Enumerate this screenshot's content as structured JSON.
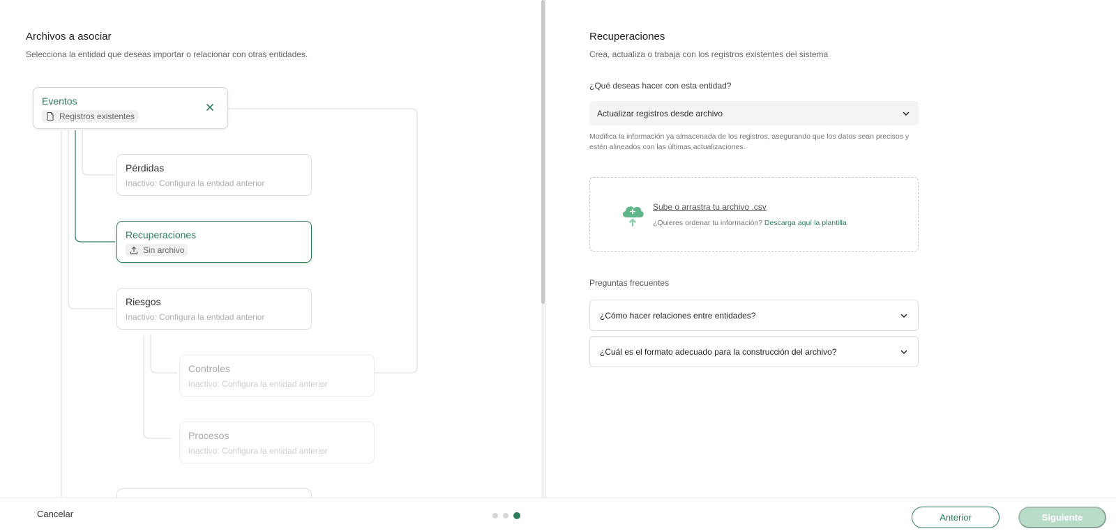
{
  "left": {
    "title": "Archivos a asociar",
    "subtitle": "Selecciona la entidad que deseas importar o relacionar con otras entidades.",
    "root": {
      "title": "Eventos",
      "chip_label": "Registros existentes",
      "chip_icon": "file-icon"
    },
    "nodes": [
      {
        "title": "Pérdidas",
        "subtitle": "Inactivo: Configura la entidad anterior",
        "state": "inactive"
      },
      {
        "title": "Recuperaciones",
        "chip_label": "Sin archivo",
        "chip_icon": "upload-icon",
        "state": "active"
      },
      {
        "title": "Riesgos",
        "subtitle": "Inactivo: Configura la entidad anterior",
        "state": "inactive"
      },
      {
        "title": "Controles",
        "subtitle": "Inactivo: Configura la entidad anterior",
        "state": "disabled"
      },
      {
        "title": "Procesos",
        "subtitle": "Inactivo: Configura la entidad anterior",
        "state": "disabled"
      }
    ]
  },
  "right": {
    "title": "Recuperaciones",
    "subtitle": "Crea, actualiza o trabaja con los registros existentes del sistema",
    "question": "¿Qué deseas hacer con esta entidad?",
    "select_value": "Actualizar registros desde archivo",
    "description": "Modifica la información ya almacenada de los registros, asegurando que los datos sean precisos y estén alineados con las últimas actualizaciones.",
    "upload": {
      "link_text": "Sube o arrastra tu archivo .csv",
      "hint_text": "¿Quieres ordenar tu información?",
      "template_link": "Descarga aquí la plantilla"
    },
    "faq_title": "Preguntas frecuentes",
    "faq": [
      {
        "question": "¿Cómo hacer relaciones entre entidades?"
      },
      {
        "question": "¿Cuál es el formato adecuado para la construcción del archivo?"
      }
    ]
  },
  "footer": {
    "cancel": "Cancelar",
    "step_current": 3,
    "step_total": 3,
    "prev": "Anterior",
    "next": "Siguiente"
  },
  "colors": {
    "accent": "#2e7d5a",
    "accent_disabled": "#b9dcc8",
    "border": "#dedede",
    "muted_text": "#b0b0b0"
  }
}
